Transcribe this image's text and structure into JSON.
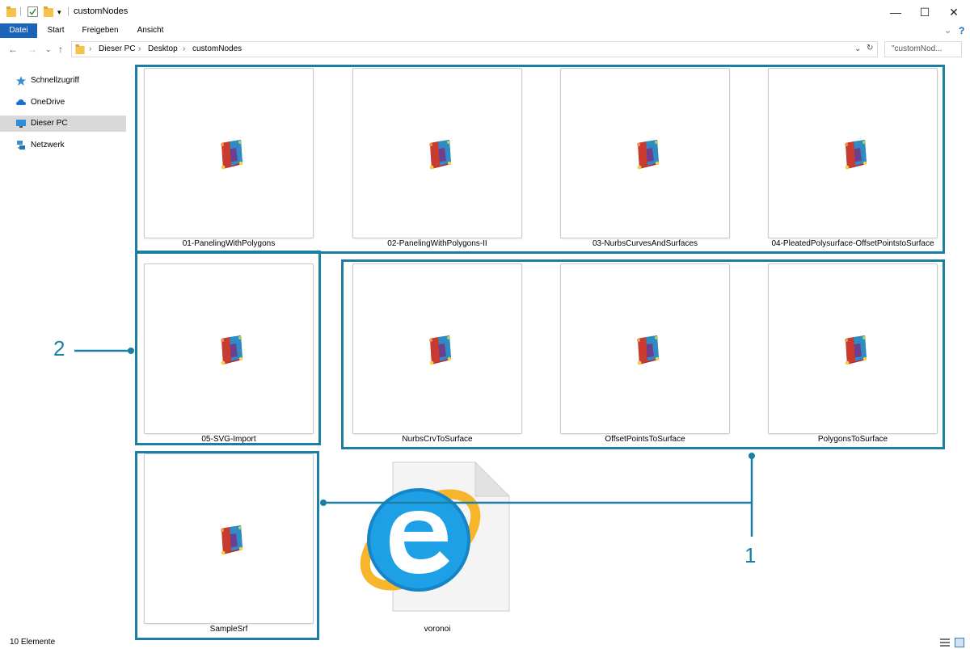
{
  "window": {
    "title": "customNodes",
    "controls": {
      "minimize": "—",
      "maximize": "☐",
      "close": "✕"
    }
  },
  "ribbon": {
    "tabs": [
      "Datei",
      "Start",
      "Freigeben",
      "Ansicht"
    ]
  },
  "address": {
    "breadcrumbs": [
      "Dieser PC",
      "Desktop",
      "customNodes"
    ],
    "search_placeholder": "\"customNod..."
  },
  "sidebar": {
    "items": [
      {
        "label": "Schnellzugriff",
        "icon": "star-icon"
      },
      {
        "label": "OneDrive",
        "icon": "cloud-icon"
      },
      {
        "label": "Dieser PC",
        "icon": "computer-icon"
      },
      {
        "label": "Netzwerk",
        "icon": "network-icon"
      }
    ]
  },
  "files": [
    {
      "name": "01-PanelingWithPolygons",
      "icon": "dynamo-logo-icon"
    },
    {
      "name": "02-PanelingWithPolygons-II",
      "icon": "dynamo-logo-icon"
    },
    {
      "name": "03-NurbsCurvesAndSurfaces",
      "icon": "dynamo-logo-icon"
    },
    {
      "name": "04-PleatedPolysurface-OffsetPointstoSurface",
      "icon": "dynamo-logo-icon"
    },
    {
      "name": "05-SVG-Import",
      "icon": "dynamo-logo-icon"
    },
    {
      "name": "NurbsCrvToSurface",
      "icon": "dynamo-logo-icon"
    },
    {
      "name": "OffsetPointsToSurface",
      "icon": "dynamo-logo-icon"
    },
    {
      "name": "PolygonsToSurface",
      "icon": "dynamo-logo-icon"
    },
    {
      "name": "SampleSrf",
      "icon": "dynamo-logo-icon"
    },
    {
      "name": "voronoi",
      "icon": "internet-explorer-file-icon"
    }
  ],
  "status": {
    "count": "10 Elemente"
  },
  "annotations": {
    "one": "1",
    "two": "2"
  },
  "colors": {
    "accent": "#1a7fa3",
    "datei_tab": "#1a63b9"
  }
}
